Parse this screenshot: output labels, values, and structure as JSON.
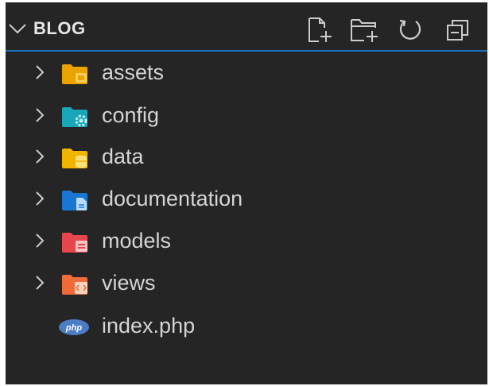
{
  "explorer": {
    "title": "BLOG",
    "actions": [
      {
        "name": "new-file",
        "icon": "new-file-icon"
      },
      {
        "name": "new-folder",
        "icon": "new-folder-icon"
      },
      {
        "name": "refresh",
        "icon": "refresh-icon"
      },
      {
        "name": "collapse-all",
        "icon": "collapse-all-icon"
      }
    ]
  },
  "tree": {
    "items": [
      {
        "label": "assets",
        "type": "folder",
        "icon": "folder-assets-icon",
        "color": "#e9a400"
      },
      {
        "label": "config",
        "type": "folder",
        "icon": "folder-config-icon",
        "color": "#18a6b8"
      },
      {
        "label": "data",
        "type": "folder",
        "icon": "folder-data-icon",
        "color": "#f0b400"
      },
      {
        "label": "documentation",
        "type": "folder",
        "icon": "folder-docs-icon",
        "color": "#1976d2"
      },
      {
        "label": "models",
        "type": "folder",
        "icon": "folder-models-icon",
        "color": "#e5474c"
      },
      {
        "label": "views",
        "type": "folder",
        "icon": "folder-views-icon",
        "color": "#ef6c3a"
      },
      {
        "label": "index.php",
        "type": "file",
        "icon": "php-icon",
        "color": "#4d7cc7"
      }
    ]
  },
  "colors": {
    "background": "#252526",
    "text": "#d4d4d4",
    "focus_border": "#1b6fbf"
  }
}
